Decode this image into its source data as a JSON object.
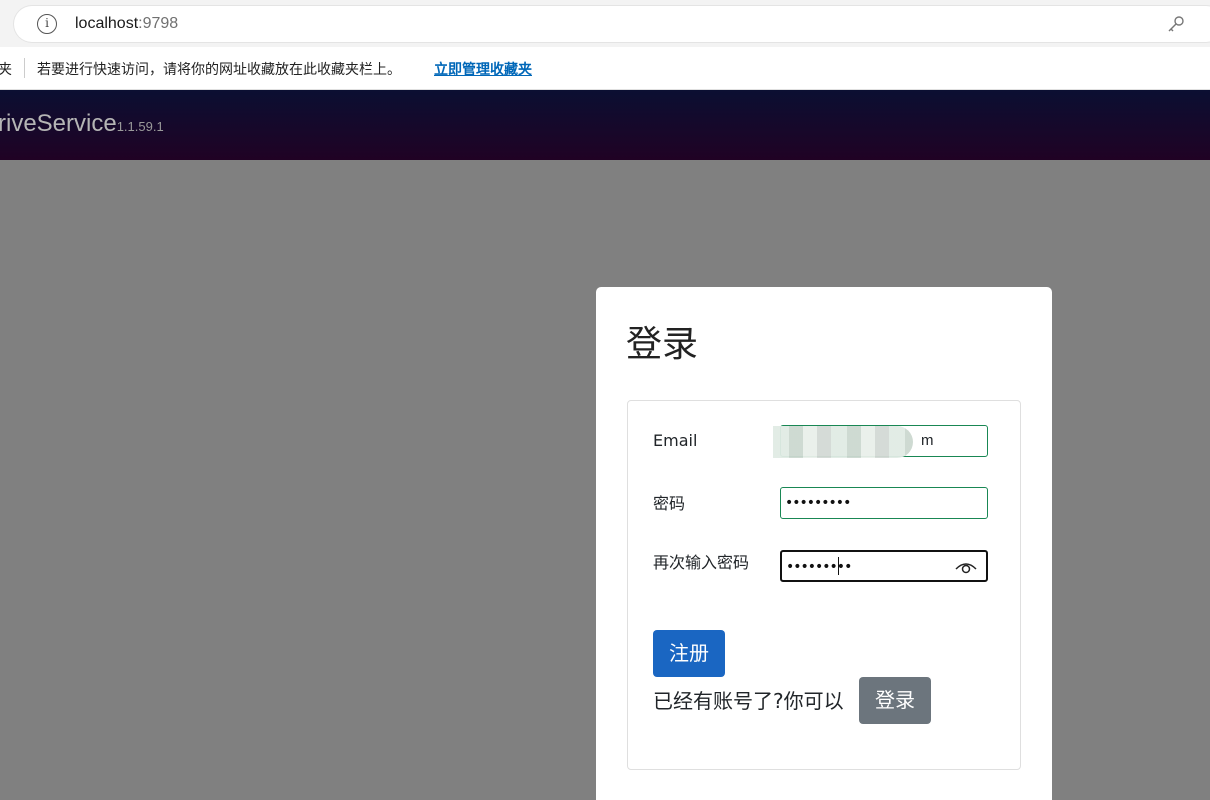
{
  "browser": {
    "url_host": "localhost",
    "url_port": ":9798",
    "info_icon_glyph": "i",
    "info_icon": "info-icon",
    "key_icon": "key-icon"
  },
  "favorites_bar": {
    "folder_label": "夹",
    "message": "若要进行快速访问，请将你的网址收藏放在此收藏夹栏上。",
    "manage_link": "立即管理收藏夹"
  },
  "header": {
    "brand": "riveService",
    "version": "1.1.59.1",
    "colors": {
      "top": "#0b0f32",
      "bottom": "#200224"
    }
  },
  "login_card": {
    "title": "登录",
    "fields": {
      "email_label": "Email",
      "email_value_visible": "m",
      "password_label": "密码",
      "password_value": "•••••••••",
      "confirm_label": "再次输入密码",
      "confirm_value": "•••••••••"
    },
    "register_button": "注册",
    "have_account_text": "已经有账号了?你可以",
    "login_button": "登录",
    "colors": {
      "primary": "#1a66c2",
      "secondary": "#6c757d",
      "valid_border": "#198754"
    }
  }
}
